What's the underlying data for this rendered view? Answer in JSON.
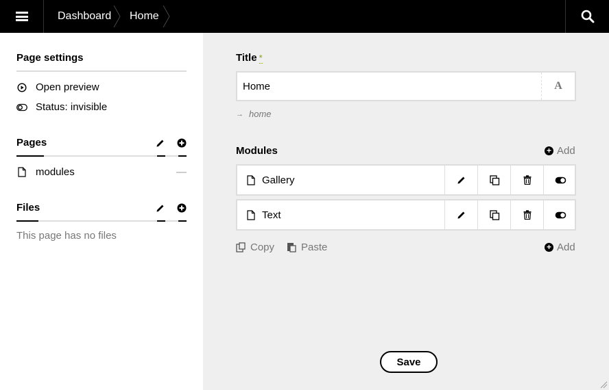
{
  "topbar": {
    "breadcrumbs": [
      {
        "label": "Dashboard"
      },
      {
        "label": "Home"
      }
    ]
  },
  "sidebar": {
    "page_settings": {
      "heading": "Page settings",
      "items": [
        {
          "label": "Open preview",
          "icon": "play-circle-icon"
        },
        {
          "label": "Status: invisible",
          "icon": "toggle-off-icon"
        }
      ]
    },
    "pages": {
      "heading": "Pages",
      "items": [
        {
          "label": "modules",
          "icon": "page-icon",
          "status": "—"
        }
      ]
    },
    "files": {
      "heading": "Files",
      "empty_text": "This page has no files"
    }
  },
  "main": {
    "title_field": {
      "label": "Title",
      "required_mark": "*",
      "value": "Home",
      "slug": "home"
    },
    "modules": {
      "label": "Modules",
      "add_label": "Add",
      "items": [
        {
          "label": "Gallery"
        },
        {
          "label": "Text"
        }
      ],
      "copy_label": "Copy",
      "paste_label": "Paste"
    },
    "save_label": "Save"
  },
  "colors": {
    "topbar": "#000000",
    "main_background": "#efefef",
    "required": "#8a9b2a",
    "muted_text": "#777777",
    "border": "#dddddd"
  }
}
